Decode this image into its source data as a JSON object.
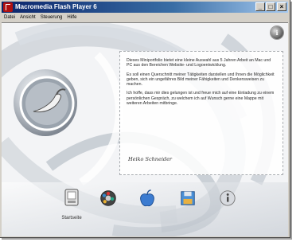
{
  "window": {
    "title": "Macromedia Flash Player 6"
  },
  "menu": [
    "Datei",
    "Ansicht",
    "Steuerung",
    "Hilfe"
  ],
  "intro": {
    "paragraphs": [
      "Dieses Miniportfolio bietet eine kleine Auswahl aus 5 Jahren Arbeit an Mac und PC aus den Bereichen  Website- und Logoentwicklung.",
      "Es soll einen Querschnitt meiner Tätigkeiten darstellen und Ihnen die Möglichkeit geben, sich ein ungefähres Bild meiner Fähigkeiten und Denkensweisen zu machen.",
      "Ich hoffe, dass mir dies gelungen ist und freue mich auf eine Einladung zu einem persönlichen Gespräch, zu welchem ich auf Wunsch gerne eine Mappe mit weiteren Arbeiten mitbringe."
    ],
    "signature": "Heiko Schneider"
  },
  "nav": {
    "active_label": "Startseite"
  },
  "icons": {
    "app": "flash-player-icon",
    "info": "info-icon",
    "pepper": "chili-pepper-icon",
    "nav": [
      "home-icon",
      "film-reel-icon",
      "apple-icon",
      "disk-icon",
      "info-circle-icon"
    ]
  }
}
